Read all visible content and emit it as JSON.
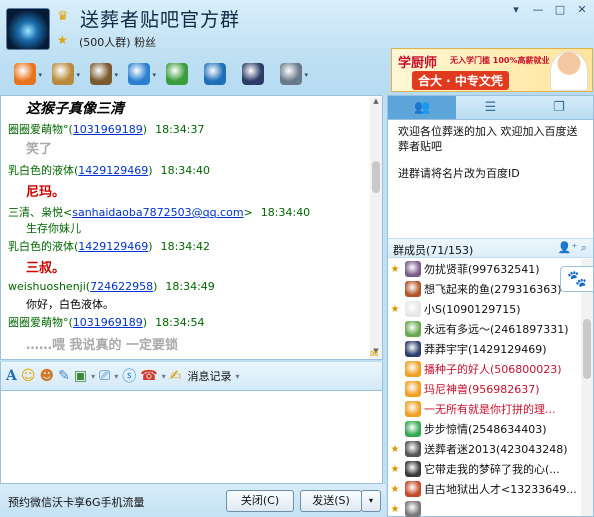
{
  "header": {
    "title": "送葬者贴吧官方群",
    "subtitle": "(500人群) 粉丝",
    "window_buttons": [
      "▾",
      "—",
      "□",
      "✕"
    ]
  },
  "toolbar": {
    "items": [
      {
        "icon": "home-icon",
        "color": "#e8731c"
      },
      {
        "icon": "folder-icon",
        "color": "#b98a3c"
      },
      {
        "icon": "album-icon",
        "color": "#7a5a2e"
      },
      {
        "icon": "share-icon",
        "color": "#2a7fd0"
      },
      {
        "icon": "add-app-icon",
        "color": "#3a9c3a"
      },
      {
        "icon": "video-icon",
        "color": "#1f6fb8"
      },
      {
        "icon": "police-icon",
        "color": "#2b3d66"
      },
      {
        "icon": "settings-icon",
        "color": "#6a7a8a"
      }
    ]
  },
  "ad": {
    "brand": "学厨师",
    "tagline": "无入学门槛  100%高薪就业",
    "school": "合大 · 中专文凭"
  },
  "chat": {
    "messages": [
      {
        "type": "content",
        "text": "这猴子真像三清",
        "color": "#000000",
        "bold": true,
        "italic": true,
        "size": 14
      },
      {
        "type": "sender",
        "name": "圈圈爱萌物°",
        "qq": "1031969189",
        "time": "18:34:37"
      },
      {
        "type": "content",
        "text": "笑了",
        "color": "#aaaaaa",
        "bold": true,
        "italic": false,
        "size": 13
      },
      {
        "type": "sender",
        "name": "乳白色的液体",
        "qq": "1429129469",
        "time": "18:34:40"
      },
      {
        "type": "content",
        "text": "尼玛。",
        "color": "#cc0000",
        "bold": true,
        "italic": false,
        "size": 13
      },
      {
        "type": "sender",
        "name": "三清、枭悦<",
        "qq": "sanhaidaoba7872503@qq.com",
        "name_suffix": ">",
        "time": "18:34:40"
      },
      {
        "type": "content",
        "text": "生存你妹儿",
        "color": "#006600",
        "bold": false,
        "italic": false,
        "size": 11
      },
      {
        "type": "sender",
        "name": "乳白色的液体",
        "qq": "1429129469",
        "time": "18:34:42"
      },
      {
        "type": "content",
        "text": "三叔。",
        "color": "#cc0000",
        "bold": true,
        "italic": false,
        "size": 13
      },
      {
        "type": "sender",
        "name": "weishuoshenji",
        "qq": "724622958",
        "time": "18:34:49"
      },
      {
        "type": "content",
        "text": "你好，白色液体。",
        "color": "#000000",
        "bold": false,
        "italic": false,
        "size": 11
      },
      {
        "type": "sender",
        "name": "圈圈爱萌物°",
        "qq": "1031969189",
        "time": "18:34:54"
      },
      {
        "type": "content",
        "text": "……喂 我说真的 一定要锁",
        "color": "#aaaaaa",
        "bold": true,
        "italic": false,
        "size": 13
      }
    ]
  },
  "input_toolbar": {
    "history_label": "消息记录"
  },
  "bottom": {
    "promo": "预约微信沃卡享6G手机流量",
    "close_label": "关闭(C)",
    "send_label": "发送(S)",
    "send_dropdown": "▾"
  },
  "right_panel": {
    "notice_lines": [
      "欢迎各位葬迷的加入 欢迎加入百度送葬者贴吧",
      "进群请将名片改为百度ID"
    ],
    "members_label": "群成员(71/153)",
    "members": [
      {
        "name": "勿扰贤菲(997632541)",
        "star": true,
        "red": false,
        "avatar_color": "#7a5c8a"
      },
      {
        "name": "想飞起来的鱼(279316363)",
        "star": false,
        "red": false,
        "avatar_color": "#b3542a"
      },
      {
        "name": "小S(1090129715)",
        "star": true,
        "red": false,
        "avatar_color": "#e6e6e6"
      },
      {
        "name": "永远有多远～(2461897331)",
        "star": false,
        "red": false,
        "avatar_color": "#6aa84f"
      },
      {
        "name": "莽莽宇宇(1429129469)",
        "star": false,
        "red": false,
        "avatar_color": "#2d3f6e"
      },
      {
        "name": "播种子的好人(506800023)",
        "star": false,
        "red": true,
        "avatar_color": "#f0a020"
      },
      {
        "name": "玛尼神兽(956982637)",
        "star": false,
        "red": true,
        "avatar_color": "#f0a020"
      },
      {
        "name": "一无所有就是你打拼的理...",
        "star": false,
        "red": true,
        "avatar_color": "#f0a020"
      },
      {
        "name": "步步惊情(2548634403)",
        "star": false,
        "red": false,
        "avatar_color": "#34a853"
      },
      {
        "name": "送葬者迷2013(423043248)",
        "star": true,
        "red": false,
        "avatar_color": "#555555"
      },
      {
        "name": "它带走我的梦碎了我的心(...",
        "star": true,
        "red": false,
        "avatar_color": "#3a3a3a"
      },
      {
        "name": "自古地狱出人才<13233649...",
        "star": true,
        "red": false,
        "avatar_color": "#c44a2a"
      },
      {
        "name": "",
        "star": true,
        "red": false,
        "avatar_color": "#777777"
      }
    ]
  }
}
